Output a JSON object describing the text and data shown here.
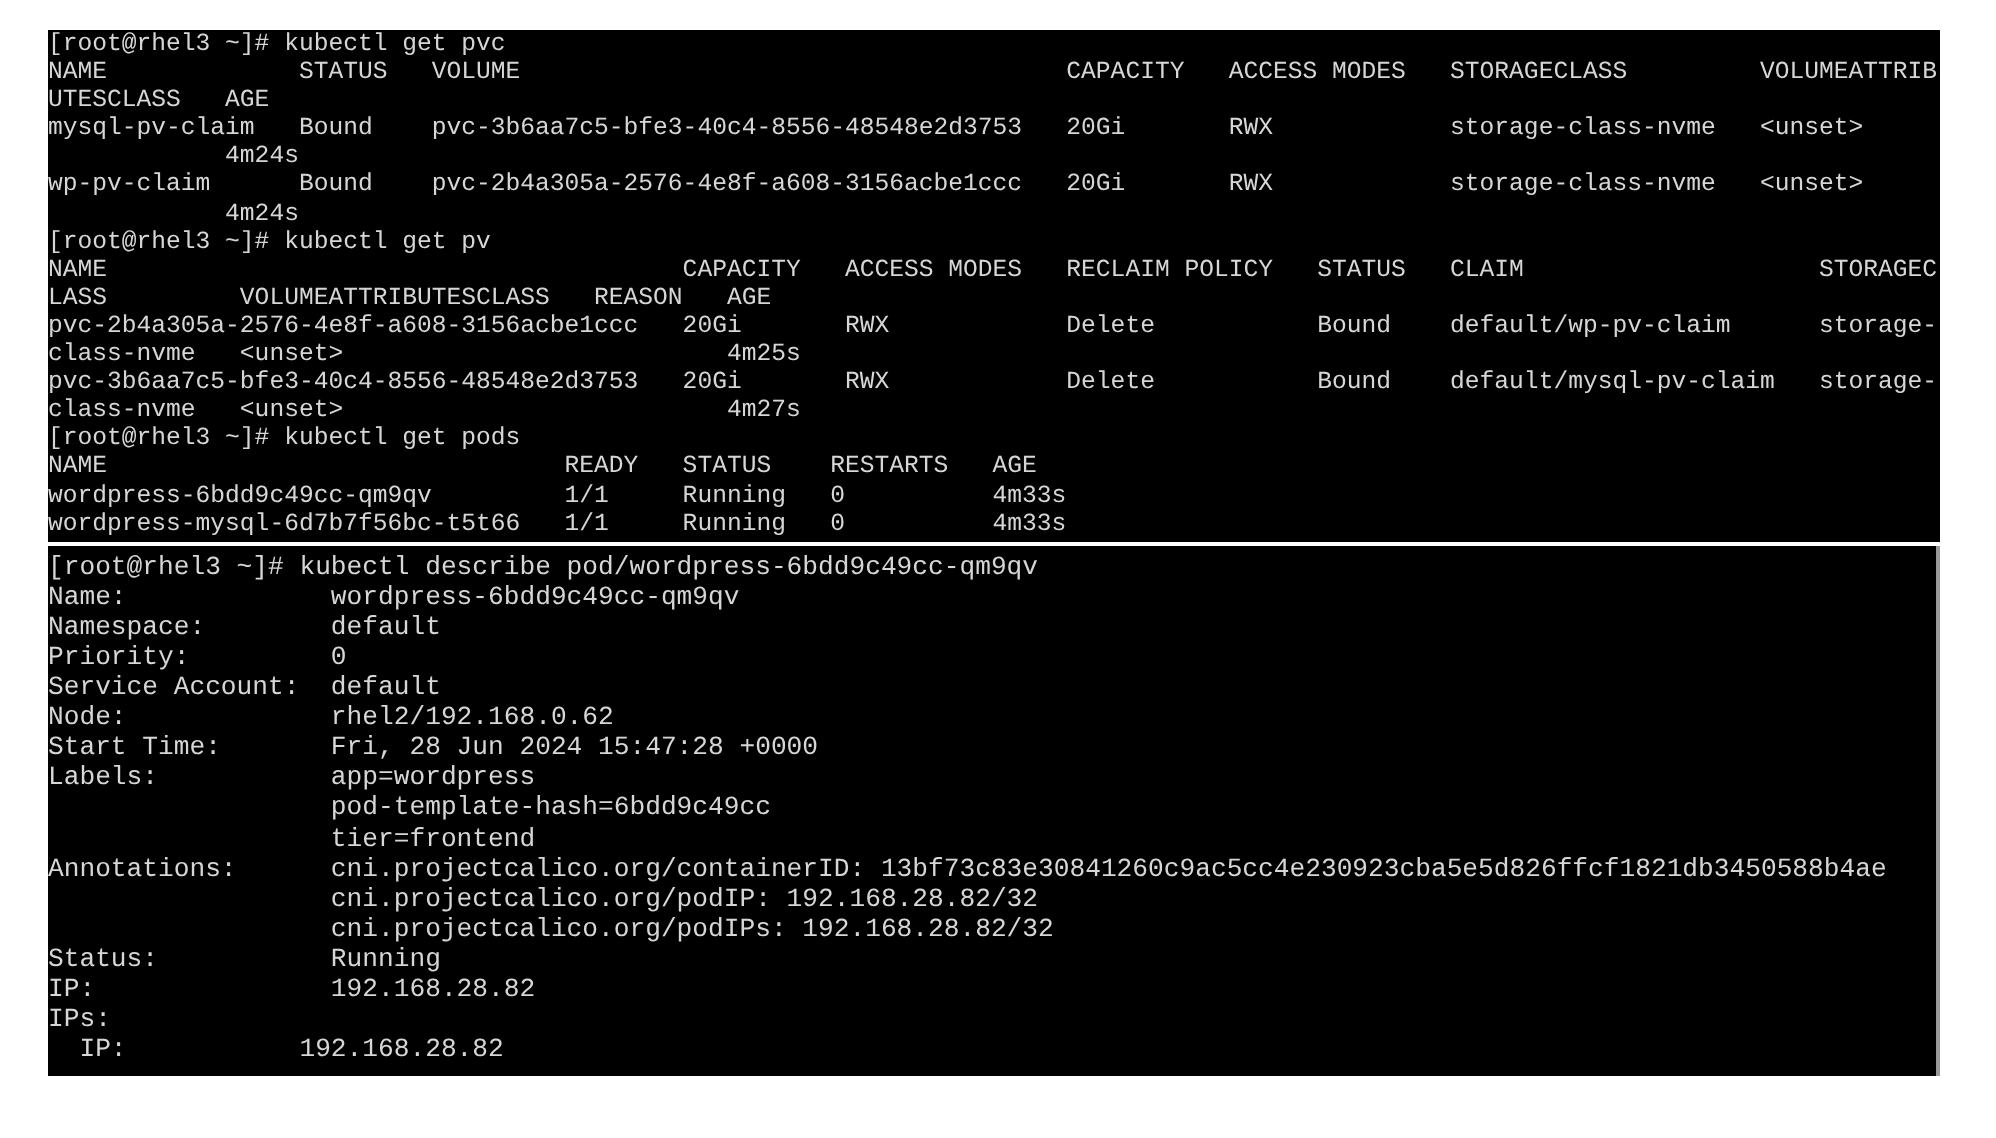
{
  "terminals": [
    {
      "lines": [
        "[root@rhel3 ~]# kubectl get pvc",
        "NAME             STATUS   VOLUME                                     CAPACITY   ACCESS MODES   STORAGECLASS         VOLUMEATTRIB",
        "UTESCLASS   AGE",
        "mysql-pv-claim   Bound    pvc-3b6aa7c5-bfe3-40c4-8556-48548e2d3753   20Gi       RWX            storage-class-nvme   <unset>",
        "            4m24s",
        "wp-pv-claim      Bound    pvc-2b4a305a-2576-4e8f-a608-3156acbe1ccc   20Gi       RWX            storage-class-nvme   <unset>",
        "            4m24s",
        "[root@rhel3 ~]# kubectl get pv",
        "NAME                                       CAPACITY   ACCESS MODES   RECLAIM POLICY   STATUS   CLAIM                    STORAGEC",
        "LASS         VOLUMEATTRIBUTESCLASS   REASON   AGE",
        "pvc-2b4a305a-2576-4e8f-a608-3156acbe1ccc   20Gi       RWX            Delete           Bound    default/wp-pv-claim      storage-",
        "class-nvme   <unset>                          4m25s",
        "pvc-3b6aa7c5-bfe3-40c4-8556-48548e2d3753   20Gi       RWX            Delete           Bound    default/mysql-pv-claim   storage-",
        "class-nvme   <unset>                          4m27s",
        "[root@rhel3 ~]# kubectl get pods",
        "NAME                               READY   STATUS    RESTARTS   AGE",
        "wordpress-6bdd9c49cc-qm9qv         1/1     Running   0          4m33s",
        "wordpress-mysql-6d7b7f56bc-t5t66   1/1     Running   0          4m33s"
      ]
    },
    {
      "lines": [
        "[root@rhel3 ~]# kubectl describe pod/wordpress-6bdd9c49cc-qm9qv",
        "Name:             wordpress-6bdd9c49cc-qm9qv",
        "Namespace:        default",
        "Priority:         0",
        "Service Account:  default",
        "Node:             rhel2/192.168.0.62",
        "Start Time:       Fri, 28 Jun 2024 15:47:28 +0000",
        "Labels:           app=wordpress",
        "                  pod-template-hash=6bdd9c49cc",
        "                  tier=frontend",
        "Annotations:      cni.projectcalico.org/containerID: 13bf73c83e30841260c9ac5cc4e230923cba5e5d826ffcf1821db3450588b4ae",
        "                  cni.projectcalico.org/podIP: 192.168.28.82/32",
        "                  cni.projectcalico.org/podIPs: 192.168.28.82/32",
        "Status:           Running",
        "IP:               192.168.28.82",
        "IPs:",
        "  IP:           192.168.28.82"
      ]
    }
  ]
}
